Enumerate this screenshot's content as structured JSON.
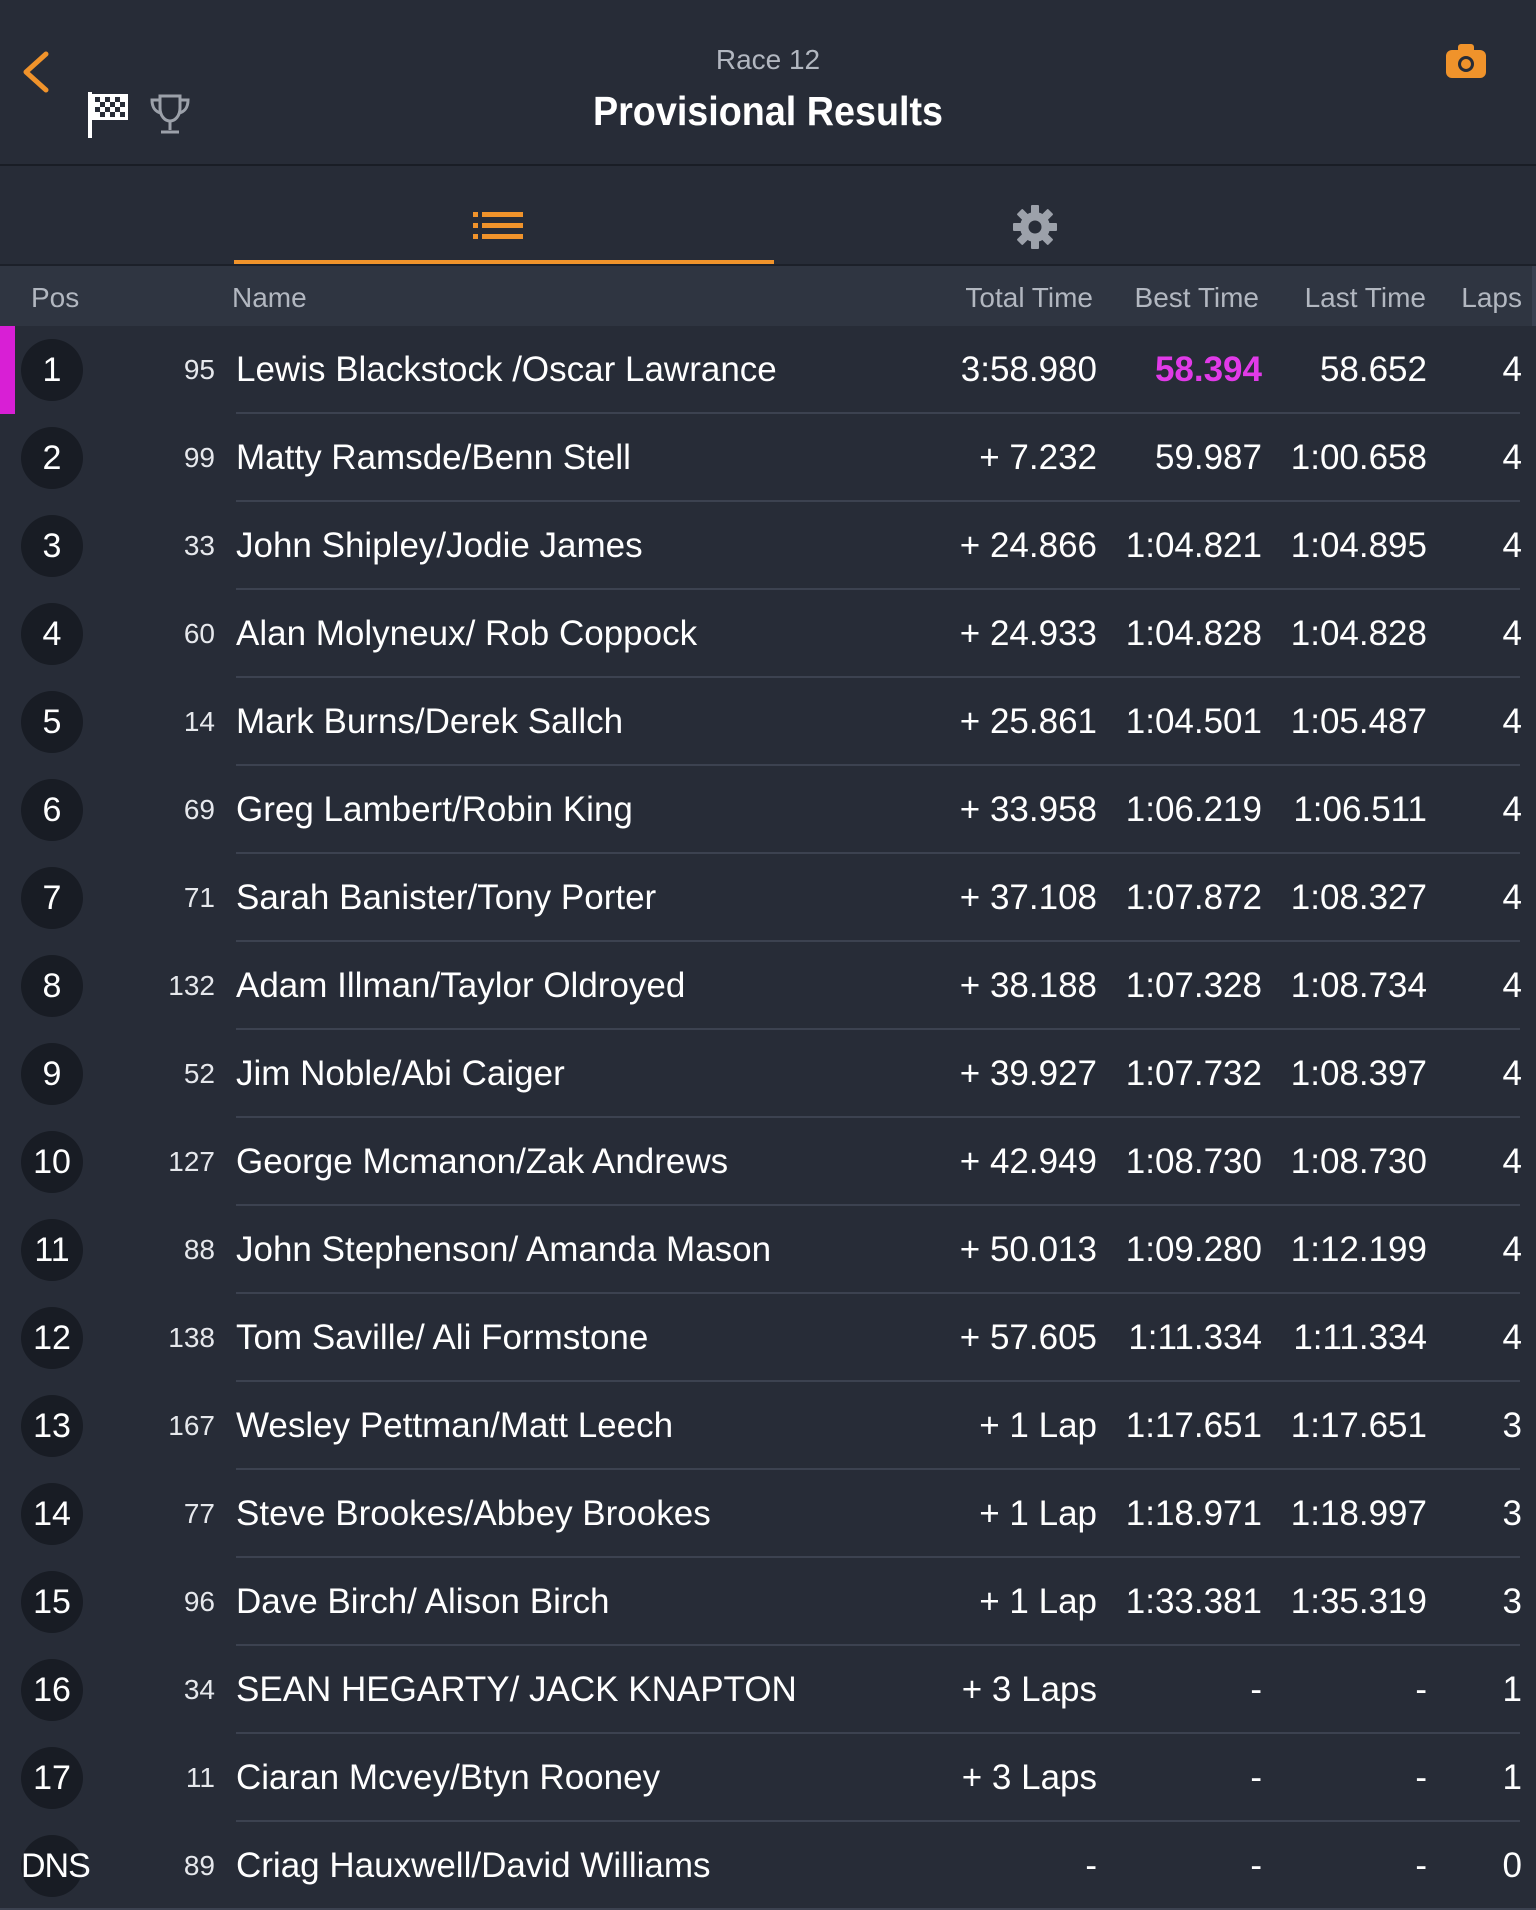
{
  "header": {
    "subtitle": "Race 12",
    "title": "Provisional Results"
  },
  "colors": {
    "accent": "#f0932b",
    "fastest_lap": "#e13ae8",
    "leader_marker": "#d81fd5",
    "background": "#272c37"
  },
  "icons": {
    "back": "chevron-left-icon",
    "flag": "checkered-flag-icon",
    "trophy": "trophy-icon",
    "camera": "camera-icon",
    "list_tab": "list-icon",
    "settings_tab": "gear-icon"
  },
  "columns": {
    "pos": "Pos",
    "name": "Name",
    "total": "Total Time",
    "best": "Best Time",
    "last": "Last Time",
    "laps": "Laps"
  },
  "results": [
    {
      "pos": "1",
      "num": "95",
      "name": "Lewis Blackstock /Oscar Lawrance",
      "total": "3:58.980",
      "best": "58.394",
      "last": "58.652",
      "laps": "4",
      "fastest": true
    },
    {
      "pos": "2",
      "num": "99",
      "name": "Matty Ramsde/Benn Stell",
      "total": "+ 7.232",
      "best": "59.987",
      "last": "1:00.658",
      "laps": "4"
    },
    {
      "pos": "3",
      "num": "33",
      "name": "John Shipley/Jodie James",
      "total": "+ 24.866",
      "best": "1:04.821",
      "last": "1:04.895",
      "laps": "4"
    },
    {
      "pos": "4",
      "num": "60",
      "name": "Alan Molyneux/ Rob Coppock",
      "total": "+ 24.933",
      "best": "1:04.828",
      "last": "1:04.828",
      "laps": "4"
    },
    {
      "pos": "5",
      "num": "14",
      "name": "Mark Burns/Derek Sallch",
      "total": "+ 25.861",
      "best": "1:04.501",
      "last": "1:05.487",
      "laps": "4"
    },
    {
      "pos": "6",
      "num": "69",
      "name": "Greg Lambert/Robin King",
      "total": "+ 33.958",
      "best": "1:06.219",
      "last": "1:06.511",
      "laps": "4"
    },
    {
      "pos": "7",
      "num": "71",
      "name": "Sarah Banister/Tony Porter",
      "total": "+ 37.108",
      "best": "1:07.872",
      "last": "1:08.327",
      "laps": "4"
    },
    {
      "pos": "8",
      "num": "132",
      "name": "Adam Illman/Taylor Oldroyed",
      "total": "+ 38.188",
      "best": "1:07.328",
      "last": "1:08.734",
      "laps": "4"
    },
    {
      "pos": "9",
      "num": "52",
      "name": "Jim Noble/Abi Caiger",
      "total": "+ 39.927",
      "best": "1:07.732",
      "last": "1:08.397",
      "laps": "4"
    },
    {
      "pos": "10",
      "num": "127",
      "name": "George Mcmanon/Zak Andrews",
      "total": "+ 42.949",
      "best": "1:08.730",
      "last": "1:08.730",
      "laps": "4"
    },
    {
      "pos": "11",
      "num": "88",
      "name": "John Stephenson/ Amanda Mason",
      "total": "+ 50.013",
      "best": "1:09.280",
      "last": "1:12.199",
      "laps": "4"
    },
    {
      "pos": "12",
      "num": "138",
      "name": "Tom Saville/ Ali Formstone",
      "total": "+ 57.605",
      "best": "1:11.334",
      "last": "1:11.334",
      "laps": "4"
    },
    {
      "pos": "13",
      "num": "167",
      "name": "Wesley Pettman/Matt Leech",
      "total": "+ 1 Lap",
      "best": "1:17.651",
      "last": "1:17.651",
      "laps": "3"
    },
    {
      "pos": "14",
      "num": "77",
      "name": "Steve Brookes/Abbey Brookes",
      "total": "+ 1 Lap",
      "best": "1:18.971",
      "last": "1:18.997",
      "laps": "3"
    },
    {
      "pos": "15",
      "num": "96",
      "name": "Dave Birch/ Alison Birch",
      "total": "+ 1 Lap",
      "best": "1:33.381",
      "last": "1:35.319",
      "laps": "3"
    },
    {
      "pos": "16",
      "num": "34",
      "name": "SEAN HEGARTY/ JACK KNAPTON",
      "total": "+ 3 Laps",
      "best": "-",
      "last": "-",
      "laps": "1"
    },
    {
      "pos": "17",
      "num": "11",
      "name": "Ciaran Mcvey/Btyn Rooney",
      "total": "+ 3 Laps",
      "best": "-",
      "last": "-",
      "laps": "1"
    },
    {
      "pos": "DNS",
      "num": "89",
      "name": "Criag Hauxwell/David Williams",
      "total": "-",
      "best": "-",
      "last": "-",
      "laps": "0"
    }
  ]
}
